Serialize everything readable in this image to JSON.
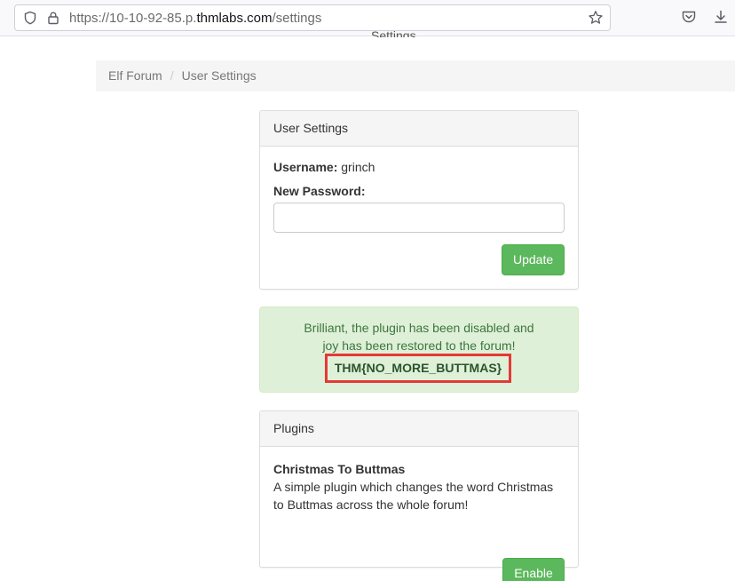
{
  "browser": {
    "url_prefix": "https://10-10-92-85.p.",
    "url_host": "thmlabs.com",
    "url_path": "/settings",
    "clipped_text": "Settings"
  },
  "breadcrumb": {
    "items": [
      "Elf Forum",
      "User Settings"
    ],
    "separator": "/"
  },
  "settings_panel": {
    "title": "User Settings",
    "username_label": "Username:",
    "username_value": "grinch",
    "password_label": "New Password:",
    "password_value": "",
    "update_label": "Update"
  },
  "alert": {
    "message": "Brilliant, the plugin has been disabled and joy has been restored to the forum!",
    "flag": "THM{NO_MORE_BUTTMAS}"
  },
  "plugins_panel": {
    "title": "Plugins",
    "plugin_name": "Christmas To Buttmas",
    "plugin_description": "A simple plugin which changes the word Christmas to Buttmas across the whole forum!",
    "enable_label": "Enable"
  },
  "colors": {
    "success": "#5cb85c",
    "alert_bg": "#dff0d8",
    "highlight": "#e53935"
  }
}
